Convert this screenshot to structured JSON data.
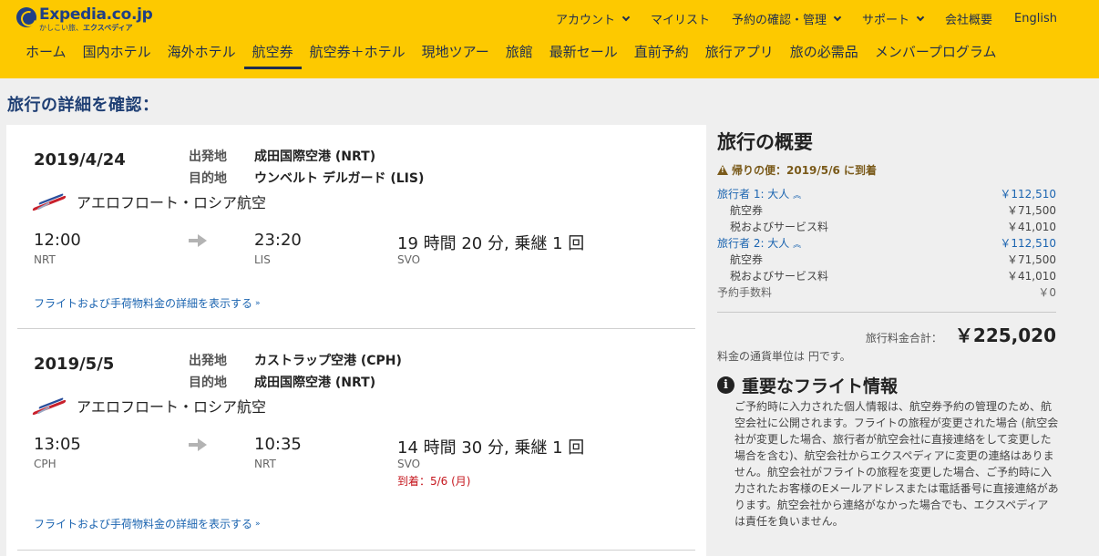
{
  "brand": {
    "name": "Expedia.co.jp",
    "tagline_small": "かしこい旅、",
    "tagline_bold": "エクスペディア"
  },
  "top_nav": [
    {
      "label": "アカウント",
      "dropdown": true
    },
    {
      "label": "マイリスト",
      "dropdown": false
    },
    {
      "label": "予約の確認・管理",
      "dropdown": true
    },
    {
      "label": "サポート",
      "dropdown": true
    },
    {
      "label": "会社概要",
      "dropdown": false
    },
    {
      "label": "English",
      "dropdown": false
    }
  ],
  "main_nav": [
    {
      "label": "ホーム"
    },
    {
      "label": "国内ホテル"
    },
    {
      "label": "海外ホテル"
    },
    {
      "label": "航空券",
      "active": true
    },
    {
      "label": "航空券＋ホテル"
    },
    {
      "label": "現地ツアー"
    },
    {
      "label": "旅館"
    },
    {
      "label": "最新セール"
    },
    {
      "label": "直前予約"
    },
    {
      "label": "旅行アプリ"
    },
    {
      "label": "旅の必需品"
    },
    {
      "label": "メンバープログラム"
    }
  ],
  "page_title": "旅行の詳細を確認：",
  "flights": [
    {
      "date": "2019/4/24",
      "origin_label": "出発地",
      "origin": "成田国際空港 (NRT)",
      "dest_label": "目的地",
      "dest": "ウンベルト デルガード (LIS)",
      "airline": "アエロフロート・ロシア航空",
      "depart_time": "12:00",
      "depart_code": "NRT",
      "arrive_time": "23:20",
      "arrive_code": "LIS",
      "duration": "19 時間 20 分, 乗継 1 回",
      "via": "SVO",
      "arrival_note": "",
      "details_link": "フライトおよび手荷物料金の詳細を表示する"
    },
    {
      "date": "2019/5/5",
      "origin_label": "出発地",
      "origin": "カストラップ空港 (CPH)",
      "dest_label": "目的地",
      "dest": "成田国際空港 (NRT)",
      "airline": "アエロフロート・ロシア航空",
      "depart_time": "13:05",
      "depart_code": "CPH",
      "arrive_time": "10:35",
      "arrive_code": "NRT",
      "duration": "14 時間 30 分, 乗継 1 回",
      "via": "SVO",
      "arrival_note": "到着：5/6 (月)",
      "details_link": "フライトおよび手荷物料金の詳細を表示する"
    }
  ],
  "summary": {
    "title": "旅行の概要",
    "warning": "帰りの便：2019/5/6 に到着",
    "travelers": [
      {
        "label": "旅行者 1: 大人",
        "total": "￥112,510",
        "fare_label": "航空券",
        "fare": "￥71,500",
        "tax_label": "税およびサービス料",
        "tax": "￥41,010"
      },
      {
        "label": "旅行者 2: 大人",
        "total": "￥112,510",
        "fare_label": "航空券",
        "fare": "￥71,500",
        "tax_label": "税およびサービス料",
        "tax": "￥41,010"
      }
    ],
    "booking_fee_label": "予約手数料",
    "booking_fee": "￥0",
    "total_label": "旅行料金合計：",
    "total": "￥225,020",
    "currency_note": "料金の通貨単位は 円です。",
    "info_title": "重要なフライト情報",
    "info_body": "ご予約時に入力された個人情報は、航空券予約の管理のため、航空会社に公開されます。フライトの旅程が変更された場合 (航空会社が変更した場合、旅行者が航空会社に直接連絡をして変更した場合を含む)、航空会社からエクスペディアに変更の連絡はありません。航空会社がフライトの旅程を変更した場合、ご予約時に入力されたお客様のEメールアドレスまたは電話番号に直接連絡があります。航空会社から連絡がなかった場合でも、エクスペディアは責任を負いません。"
  },
  "colors": {
    "header_bg": "#fdc900",
    "brand_blue": "#1f3f86",
    "link_blue": "#1b64b0",
    "alert_red": "#c5161d"
  }
}
